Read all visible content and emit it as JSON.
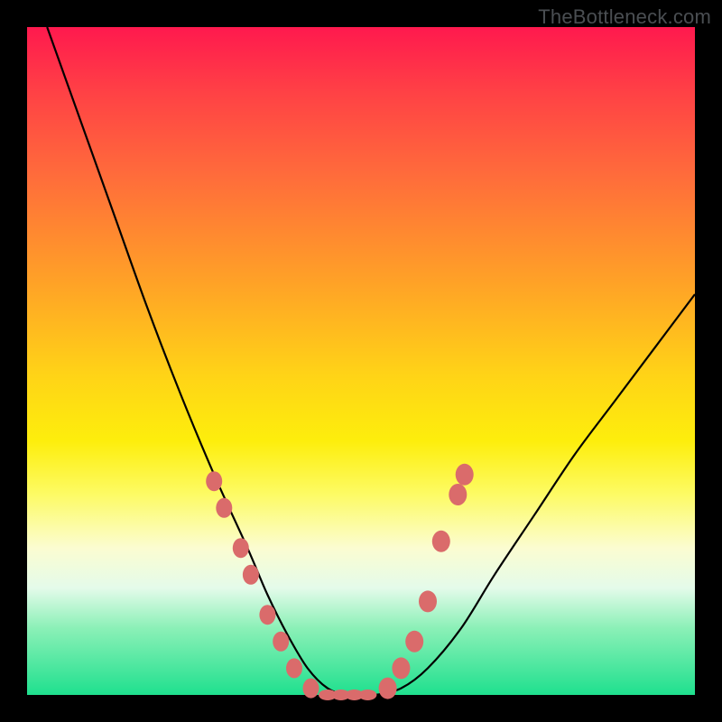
{
  "watermark": "TheBottleneck.com",
  "chart_data": {
    "type": "line",
    "title": "",
    "xlabel": "",
    "ylabel": "",
    "xlim": [
      0,
      100
    ],
    "ylim": [
      0,
      100
    ],
    "series": [
      {
        "name": "bottleneck-curve",
        "x": [
          3,
          8,
          13,
          18,
          23,
          28,
          33,
          36,
          39,
          42,
          45,
          48,
          52,
          56,
          60,
          65,
          70,
          76,
          82,
          88,
          94,
          100
        ],
        "y": [
          100,
          86,
          72,
          58,
          45,
          33,
          22,
          15,
          9,
          4,
          1,
          0,
          0,
          1,
          4,
          10,
          18,
          27,
          36,
          44,
          52,
          60
        ]
      }
    ],
    "markers_left": {
      "name": "markers-descending",
      "x": [
        28,
        29.5,
        32,
        33.5,
        36,
        38,
        40,
        42.5
      ],
      "y": [
        32,
        28,
        22,
        18,
        12,
        8,
        4,
        1
      ]
    },
    "markers_right": {
      "name": "markers-ascending",
      "x": [
        54,
        56,
        58,
        60,
        62,
        64.5,
        65.5
      ],
      "y": [
        1,
        4,
        8,
        14,
        23,
        30,
        33
      ]
    },
    "markers_bottom": {
      "name": "markers-bottom",
      "x": [
        45,
        47,
        49,
        51
      ],
      "y": [
        0,
        0,
        0,
        0
      ]
    },
    "marker_color": "#da6b6b",
    "curve_color": "#000000",
    "gradient_stops": [
      {
        "pos": 0,
        "color": "#ff194e"
      },
      {
        "pos": 10,
        "color": "#ff4245"
      },
      {
        "pos": 22,
        "color": "#ff6b3b"
      },
      {
        "pos": 38,
        "color": "#ffa127"
      },
      {
        "pos": 52,
        "color": "#ffd317"
      },
      {
        "pos": 62,
        "color": "#fdee0c"
      },
      {
        "pos": 70,
        "color": "#fdfb65"
      },
      {
        "pos": 78,
        "color": "#fbfcd1"
      },
      {
        "pos": 84,
        "color": "#e4fbea"
      },
      {
        "pos": 90,
        "color": "#8bf0b7"
      },
      {
        "pos": 100,
        "color": "#1fe08e"
      }
    ]
  }
}
